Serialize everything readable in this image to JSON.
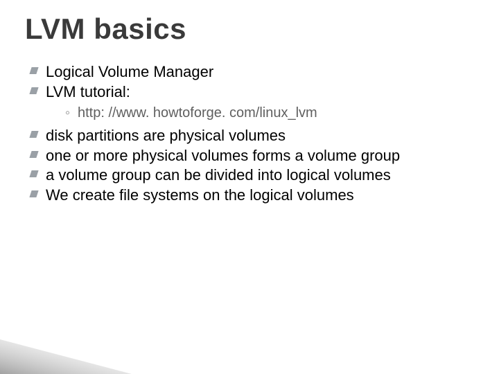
{
  "title": "LVM basics",
  "bullets": {
    "b0": "Logical Volume Manager",
    "b1": "LVM tutorial:",
    "b1_sub0": "http: //www. howtoforge. com/linux_lvm",
    "b2": "disk partitions are physical volumes",
    "b3": "one or more physical volumes forms a volume group",
    "b4": "a volume group can be divided into logical volumes",
    "b5": "We create file systems on the logical volumes"
  }
}
